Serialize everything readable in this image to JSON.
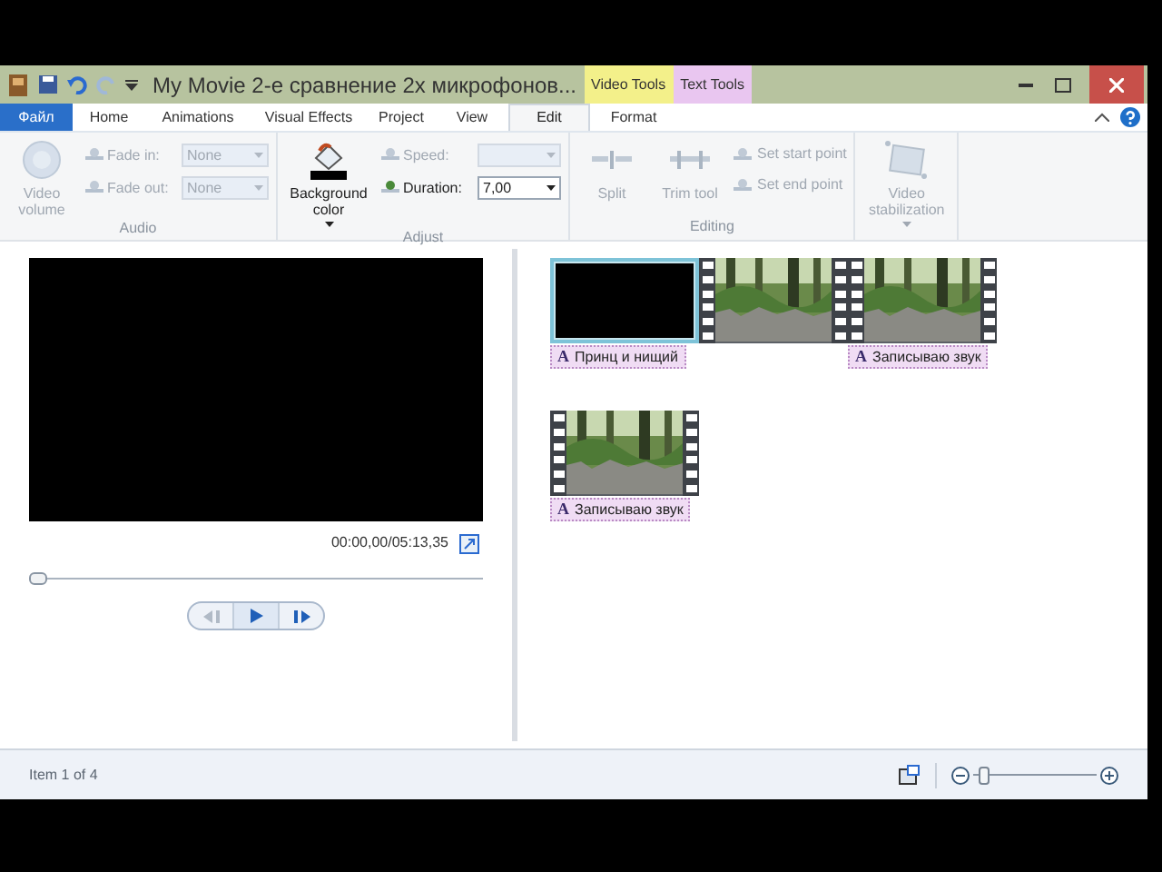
{
  "window": {
    "title": "My Movie 2-е сравнение 2х микрофонов..."
  },
  "contextual_tabs": [
    {
      "label": "Video Tools",
      "color": "#f3f08a"
    },
    {
      "label": "Text Tools",
      "color": "#e9c6f0"
    }
  ],
  "tabs": [
    {
      "label": "Файл",
      "kind": "file",
      "selected": false
    },
    {
      "label": "Home",
      "selected": false
    },
    {
      "label": "Animations",
      "selected": false
    },
    {
      "label": "Visual Effects",
      "selected": false
    },
    {
      "label": "Project",
      "selected": false
    },
    {
      "label": "View",
      "selected": false
    },
    {
      "label": "Edit",
      "selected": true
    },
    {
      "label": "Format",
      "selected": false
    }
  ],
  "ribbon": {
    "groups": [
      {
        "label": "Audio",
        "items": [
          {
            "kind": "big",
            "label": "Video volume",
            "disabled": true
          },
          {
            "kind": "dropdowns",
            "rows": [
              {
                "label": "Fade in:",
                "value": "None",
                "disabled": true
              },
              {
                "label": "Fade out:",
                "value": "None",
                "disabled": true
              }
            ]
          }
        ]
      },
      {
        "label": "Adjust",
        "items": [
          {
            "kind": "big",
            "label": "Background color",
            "dropdown": true,
            "disabled": false
          },
          {
            "kind": "dropdowns",
            "rows": [
              {
                "label": "Speed:",
                "value": "",
                "disabled": true
              },
              {
                "label": "Duration:",
                "value": "7,00",
                "disabled": false
              }
            ]
          }
        ]
      },
      {
        "label": "Editing",
        "items": [
          {
            "kind": "big",
            "label": "Split",
            "disabled": true
          },
          {
            "kind": "big",
            "label": "Trim tool",
            "disabled": true
          },
          {
            "kind": "small",
            "rows": [
              {
                "label": "Set start point",
                "disabled": true
              },
              {
                "label": "Set end point",
                "disabled": true
              }
            ]
          }
        ]
      },
      {
        "items": [
          {
            "kind": "big",
            "label": "Video stabilization",
            "dropdown": true,
            "disabled": true
          }
        ]
      }
    ]
  },
  "preview": {
    "time": "00:00,00/05:13,35",
    "seek": {
      "level": 0.0
    }
  },
  "storyboard": {
    "rows": [
      [
        {
          "kind": "blank",
          "badge": "A",
          "caption": "Принц и нищий",
          "selected": true
        },
        {
          "kind": "picture",
          "selected": false
        },
        {
          "kind": "picture",
          "badge": "A",
          "caption": "Записываю звук",
          "selected": false
        }
      ],
      [
        {
          "kind": "picture",
          "badge": "A",
          "caption": "Записываю звук",
          "selected": false
        }
      ]
    ]
  },
  "status_bar": {
    "text": "Item 1 of 4",
    "zoom": {
      "level": 0.05
    }
  }
}
